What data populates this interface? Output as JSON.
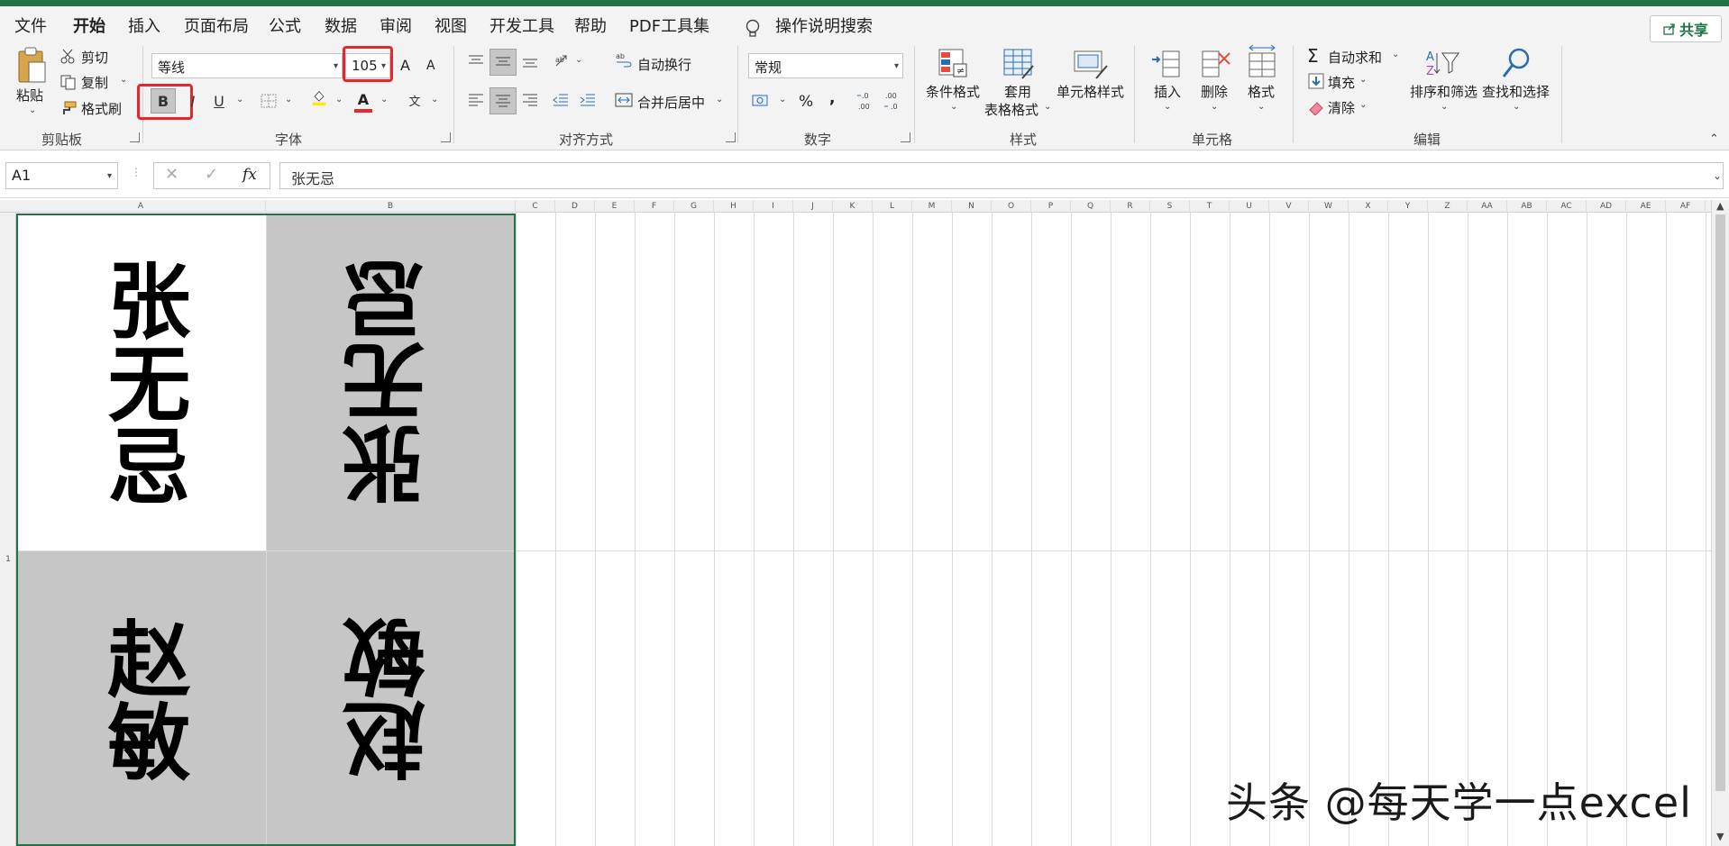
{
  "menu": {
    "tabs": [
      "文件",
      "开始",
      "插入",
      "页面布局",
      "公式",
      "数据",
      "审阅",
      "视图",
      "开发工具",
      "帮助",
      "PDF工具集"
    ],
    "active_tab": "开始",
    "search_label": "操作说明搜索",
    "share_label": "共享"
  },
  "ribbon": {
    "clipboard": {
      "paste": "粘贴",
      "cut": "剪切",
      "copy": "复制",
      "format_painter": "格式刷",
      "group_label": "剪贴板"
    },
    "font": {
      "font_name": "等线",
      "font_size": "105",
      "bold": "B",
      "italic": "I",
      "underline": "U",
      "grow": "A",
      "shrink": "A",
      "phonetic": "文",
      "font_color_glyph": "A",
      "group_label": "字体"
    },
    "alignment": {
      "wrap_text": "自动换行",
      "merge_center": "合并后居中",
      "group_label": "对齐方式"
    },
    "number": {
      "format": "常规",
      "percent": "%",
      "comma": ",",
      "inc_decimal": "←.0\n.00",
      "dec_decimal": ".00\n→.0",
      "group_label": "数字"
    },
    "styles": {
      "conditional": "条件格式",
      "table_format_1": "套用",
      "table_format_2": "表格格式",
      "cell_styles": "单元格样式",
      "group_label": "样式"
    },
    "cells": {
      "insert": "插入",
      "delete": "删除",
      "format": "格式",
      "group_label": "单元格"
    },
    "editing": {
      "autosum": "自动求和",
      "fill": "填充",
      "clear": "清除",
      "sort_filter": "排序和筛选",
      "find_select": "查找和选择",
      "group_label": "编辑"
    }
  },
  "formula_bar": {
    "name_box": "A1",
    "fx": "fx",
    "formula": "张无忌"
  },
  "sheet": {
    "columns": [
      "A",
      "B",
      "C",
      "D",
      "E",
      "F",
      "G",
      "H",
      "I",
      "J",
      "K",
      "L",
      "M",
      "N",
      "O",
      "P",
      "Q",
      "R",
      "S",
      "T",
      "U",
      "V",
      "W",
      "X",
      "Y",
      "Z",
      "AA",
      "AB",
      "AC",
      "AD",
      "AE",
      "AF"
    ],
    "rows": [
      "1"
    ],
    "cells": {
      "a1": "张无忌",
      "b1": "张无忌",
      "a2": "赵敏",
      "b2": "赵敏"
    },
    "colors": {
      "gray_fill": "#c6c6c6",
      "selection": "#217346"
    }
  },
  "watermark": "头条 @每天学一点excel"
}
